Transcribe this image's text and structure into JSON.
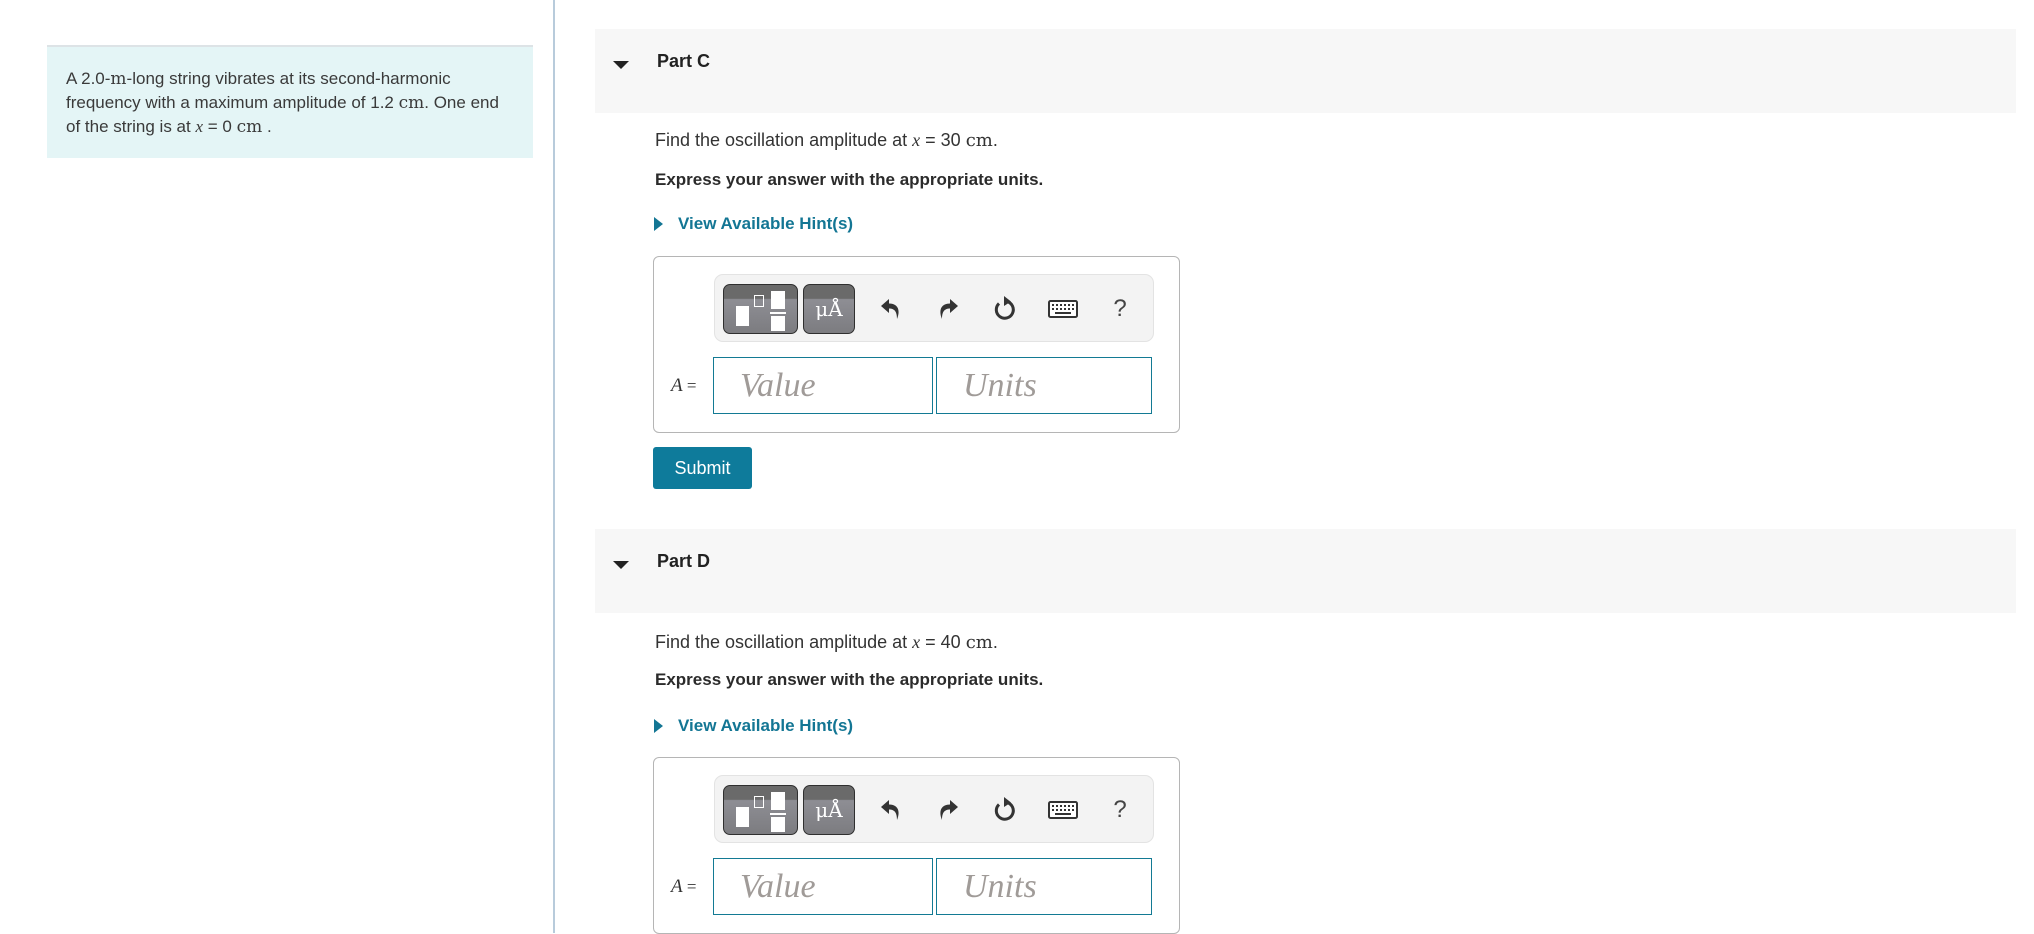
{
  "intro": {
    "text_before_m": "A 2.0-",
    "unit_m": "m",
    "text_after_m": "-long string vibrates at its second-harmonic frequency with a maximum amplitude of 1.2 ",
    "unit_cm": "cm",
    "text_end": ". One end of the string is at ",
    "var_x": "x",
    "eq": " = 0 ",
    "unit_cm2": "cm",
    "period": " ."
  },
  "parts": [
    {
      "title": "Part C",
      "question_prefix": "Find the oscillation amplitude at ",
      "var": "x",
      "question_eq": " = 30 ",
      "question_unit": "cm",
      "question_end": ".",
      "instruction": "Express your answer with the appropriate units.",
      "hint_label": "View Available Hint(s)",
      "answer_var": "A",
      "answer_eq": " =",
      "value_placeholder": "Value",
      "units_placeholder": "Units",
      "submit_label": "Submit"
    },
    {
      "title": "Part D",
      "question_prefix": "Find the oscillation amplitude at ",
      "var": "x",
      "question_eq": " = 40 ",
      "question_unit": "cm",
      "question_end": ".",
      "instruction": "Express your answer with the appropriate units.",
      "hint_label": "View Available Hint(s)",
      "answer_var": "A",
      "answer_eq": " =",
      "value_placeholder": "Value",
      "units_placeholder": "Units"
    }
  ],
  "toolbar": {
    "units_button_label": "μÅ",
    "help_label": "?",
    "icons": [
      "templates-icon",
      "units-icon",
      "undo-icon",
      "redo-icon",
      "reset-icon",
      "keyboard-icon",
      "help-icon"
    ]
  },
  "colors": {
    "accent": "#0e7b9b",
    "hint": "#137694",
    "intro_bg": "#e4f5f6",
    "header_bg": "#f7f7f7"
  }
}
